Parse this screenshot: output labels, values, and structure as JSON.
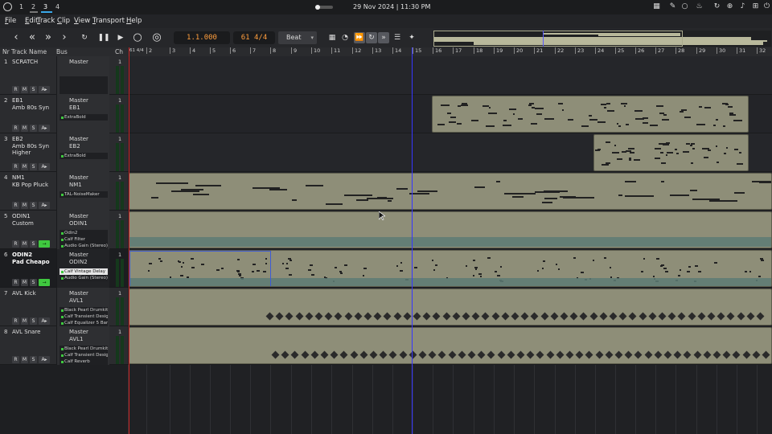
{
  "system": {
    "workspaces": [
      "1",
      "2",
      "3",
      "4"
    ],
    "active_workspace": "3",
    "datetime": "29 Nov 2024 | 11:30 PM"
  },
  "menu": {
    "items": [
      "File",
      "Edit",
      "Track",
      "Clip",
      "View",
      "Transport",
      "Help"
    ]
  },
  "transport": {
    "position": "1.1.000",
    "tempo_sig": "61 4/4",
    "snap": "Beat"
  },
  "headers": {
    "nr": "Nr",
    "track_name": "Track Name",
    "bus": "Bus",
    "ch": "Ch"
  },
  "ruler": {
    "start_label": "61 4/4",
    "bars": [
      "1",
      "2",
      "3",
      "4",
      "5",
      "6",
      "7",
      "8",
      "9",
      "10",
      "11",
      "12",
      "13",
      "14",
      "15",
      "16",
      "17",
      "18",
      "19",
      "20",
      "21",
      "22",
      "23",
      "24",
      "25",
      "26",
      "27",
      "28",
      "29",
      "30",
      "31",
      "32"
    ]
  },
  "tracks": [
    {
      "nr": "1",
      "name": "SCRATCH",
      "output": "Master",
      "group": "",
      "channel": "1",
      "plugins": [],
      "selected": false,
      "monitor": false
    },
    {
      "nr": "2",
      "name": "EB1\nAmb 80s Syn",
      "output": "Master",
      "group": "EB1",
      "channel": "1",
      "plugins": [
        "ExtraBold"
      ],
      "selected": false,
      "monitor": false
    },
    {
      "nr": "3",
      "name": "EB2\nAmb 80s Syn\nHigher",
      "output": "Master",
      "group": "EB2",
      "channel": "1",
      "plugins": [
        "ExtraBold"
      ],
      "selected": false,
      "monitor": false
    },
    {
      "nr": "4",
      "name": "NM1\nKB Pop Pluck",
      "output": "Master",
      "group": "NM1",
      "channel": "1",
      "plugins": [
        "TAL-NoiseMaker"
      ],
      "selected": false,
      "monitor": false
    },
    {
      "nr": "5",
      "name": "ODIN1\nCustom",
      "output": "Master",
      "group": "ODIN1",
      "channel": "1",
      "plugins": [
        "Odin2",
        "Calf Filter",
        "Audio Gain (Stereo)"
      ],
      "selected": false,
      "monitor": true
    },
    {
      "nr": "6",
      "name": "ODIN2\nPad Cheapo",
      "output": "Master",
      "group": "ODIN2",
      "channel": "1",
      "plugins": [
        "Calf Vintage Delay",
        "Audio Gain (Stereo)"
      ],
      "selected": true,
      "monitor": true
    },
    {
      "nr": "7",
      "name": "AVL Kick",
      "output": "Master",
      "group": "AVL1",
      "channel": "1",
      "plugins": [
        "Black Pearl Drumkit",
        "Calf Transient Design",
        "Calf Equalizer 5 Band"
      ],
      "selected": false,
      "monitor": false
    },
    {
      "nr": "8",
      "name": "AVL Snare",
      "output": "Master",
      "group": "AVL1",
      "channel": "1",
      "plugins": [
        "Black Pearl Drumkit",
        "Calf Transient Design",
        "Calf Reverb"
      ],
      "selected": false,
      "monitor": false
    }
  ],
  "track_buttons": {
    "record": "R",
    "mute": "M",
    "solo": "S",
    "auto": "A"
  },
  "colors": {
    "region": "#8e8e78",
    "playhead": "#3636ff",
    "start_marker": "#cc2222",
    "monitor_on": "#3fc83f",
    "display_text": "#ff9e3d"
  }
}
